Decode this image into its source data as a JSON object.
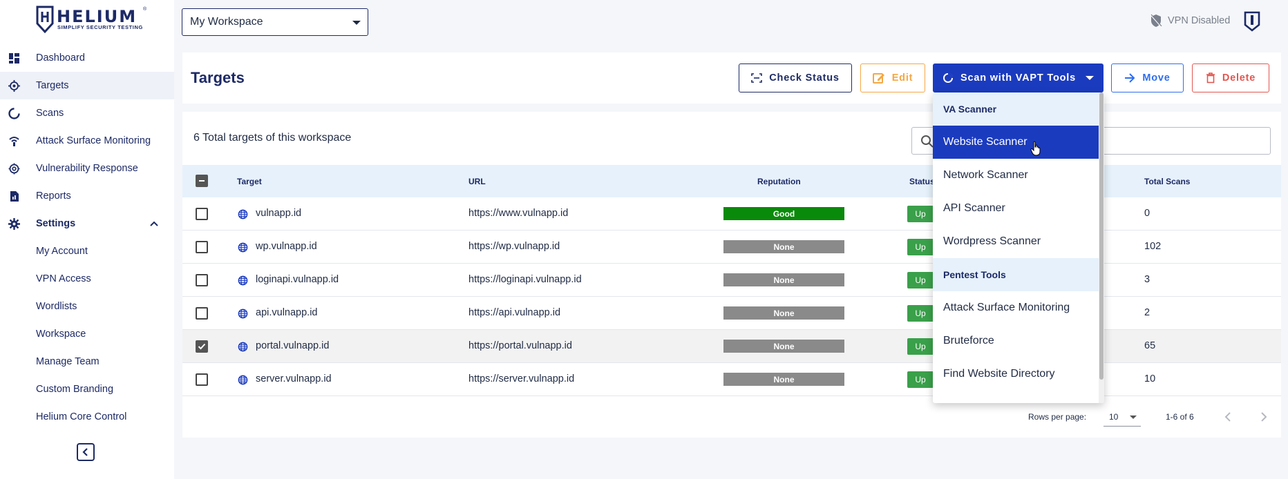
{
  "brand": {
    "name": "HELIUM",
    "tagline": "SIMPLIFY SECURITY TESTING",
    "reg": "®"
  },
  "sidebar": {
    "items": [
      {
        "label": "Dashboard",
        "icon": "dashboard-icon"
      },
      {
        "label": "Targets",
        "icon": "target-icon",
        "active": true
      },
      {
        "label": "Scans",
        "icon": "scan-icon"
      },
      {
        "label": "Attack Surface Monitoring",
        "icon": "signal-icon"
      },
      {
        "label": "Vulnerability Response",
        "icon": "bug-icon"
      },
      {
        "label": "Reports",
        "icon": "report-icon"
      },
      {
        "label": "Settings",
        "icon": "gear-icon",
        "expanded": true
      }
    ],
    "settings_items": [
      "My Account",
      "VPN Access",
      "Wordlists",
      "Workspace",
      "Manage Team",
      "Custom Branding",
      "Helium Core Control"
    ]
  },
  "topbar": {
    "workspace": "My Workspace",
    "vpn_status": "VPN Disabled"
  },
  "header": {
    "title": "Targets",
    "check_status": "Check Status",
    "edit": "Edit",
    "scan": "Scan with VAPT Tools",
    "move": "Move",
    "delete": "Delete"
  },
  "table": {
    "total_label": "6 Total targets of this workspace",
    "search_placeholder": "",
    "columns": [
      "Target",
      "URL",
      "Reputation",
      "Status",
      "Total Scans"
    ],
    "rows": [
      {
        "target": "vulnapp.id",
        "url": "https://www.vulnapp.id",
        "reputation": "Good",
        "status": "Up",
        "total_scans": "0",
        "checked": false
      },
      {
        "target": "wp.vulnapp.id",
        "url": "https://wp.vulnapp.id",
        "reputation": "None",
        "status": "Up",
        "total_scans": "102",
        "checked": false
      },
      {
        "target": "loginapi.vulnapp.id",
        "url": "https://loginapi.vulnapp.id",
        "reputation": "None",
        "status": "Up",
        "total_scans": "3",
        "checked": false
      },
      {
        "target": "api.vulnapp.id",
        "url": "https://api.vulnapp.id",
        "reputation": "None",
        "status": "Up",
        "total_scans": "2",
        "checked": false
      },
      {
        "target": "portal.vulnapp.id",
        "url": "https://portal.vulnapp.id",
        "reputation": "None",
        "status": "Up",
        "total_scans": "65",
        "checked": true
      },
      {
        "target": "server.vulnapp.id",
        "url": "https://server.vulnapp.id",
        "reputation": "None",
        "status": "Up",
        "total_scans": "10",
        "checked": false
      }
    ],
    "rows_per_page_label": "Rows per page:",
    "rows_per_page": "10",
    "range": "1-6 of 6"
  },
  "scan_menu": {
    "groups": [
      {
        "header": "VA Scanner",
        "items": [
          "Website Scanner",
          "Network Scanner",
          "API Scanner",
          "Wordpress Scanner"
        ]
      },
      {
        "header": "Pentest Tools",
        "items": [
          "Attack Surface Monitoring",
          "Bruteforce",
          "Find Website Directory"
        ]
      }
    ],
    "highlighted": "Website Scanner"
  },
  "colors": {
    "primary": "#1b3bbf",
    "navy": "#1d2a66",
    "good": "#0a8a0a",
    "none": "#8a8a8a",
    "up": "#3aa04a",
    "edit": "#f5a742",
    "move": "#2d6ef0",
    "delete": "#e2564f"
  }
}
